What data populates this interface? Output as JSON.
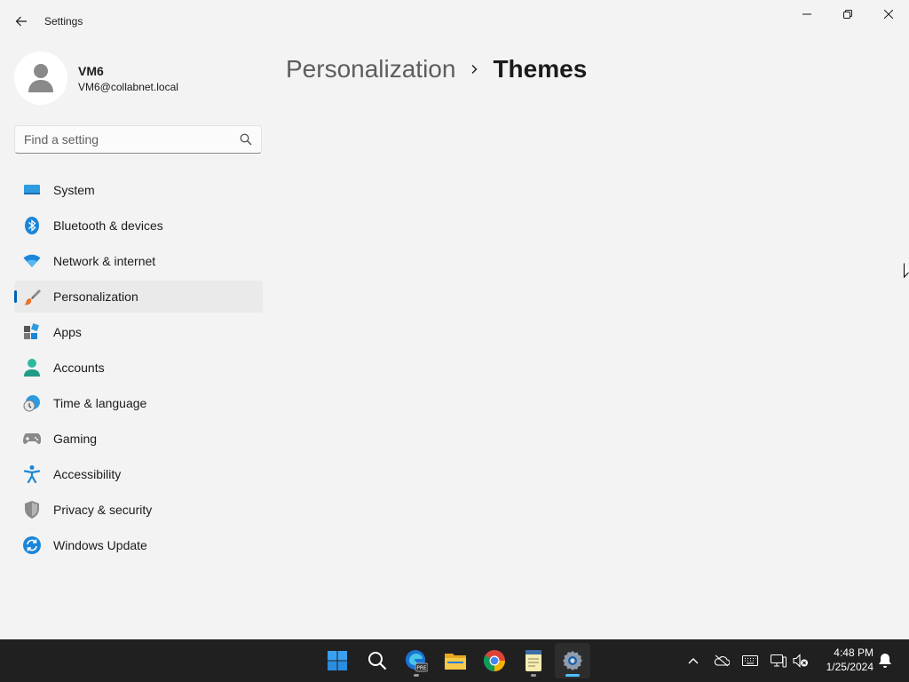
{
  "window": {
    "title": "Settings",
    "back_icon": "back-arrow-icon",
    "controls": [
      "minimize-icon",
      "restore-icon",
      "close-icon"
    ]
  },
  "profile": {
    "name": "VM6",
    "email": "VM6@collabnet.local",
    "avatar_icon": "user-avatar-icon"
  },
  "search": {
    "placeholder": "Find a setting",
    "value": "",
    "icon": "search-icon"
  },
  "sidebar": {
    "selected": "Personalization",
    "items": [
      {
        "label": "System",
        "icon": "system-icon"
      },
      {
        "label": "Bluetooth & devices",
        "icon": "bluetooth-icon"
      },
      {
        "label": "Network & internet",
        "icon": "wifi-icon"
      },
      {
        "label": "Personalization",
        "icon": "paintbrush-icon"
      },
      {
        "label": "Apps",
        "icon": "apps-icon"
      },
      {
        "label": "Accounts",
        "icon": "accounts-icon"
      },
      {
        "label": "Time & language",
        "icon": "time-language-icon"
      },
      {
        "label": "Gaming",
        "icon": "gamepad-icon"
      },
      {
        "label": "Accessibility",
        "icon": "accessibility-icon"
      },
      {
        "label": "Privacy & security",
        "icon": "shield-icon"
      },
      {
        "label": "Windows Update",
        "icon": "windows-update-icon"
      }
    ]
  },
  "breadcrumb": {
    "parent": "Personalization",
    "current": "Themes"
  },
  "taskbar": {
    "apps": [
      "start-icon",
      "search-icon",
      "edge-pre-icon",
      "file-explorer-icon",
      "chrome-icon",
      "notepad-icon",
      "settings-icon"
    ],
    "active_app": "settings-icon",
    "tray": [
      "chevron-up-icon",
      "onedrive-icon",
      "keyboard-icon",
      "network-icon",
      "volume-muted-icon"
    ],
    "time": "4:48 PM",
    "date": "1/25/2024",
    "notification_icon": "bell-icon"
  },
  "colors": {
    "background": "#f3f3f3",
    "accent": "#005fb8",
    "taskbar": "#202020",
    "active_indicator": "#4cc2ff"
  }
}
